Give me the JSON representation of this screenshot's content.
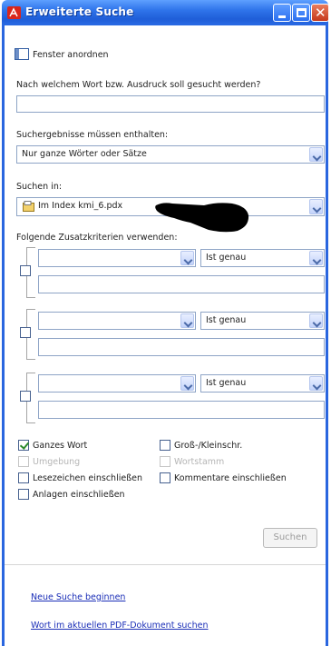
{
  "window": {
    "title": "Erweiterte Suche",
    "close_glyph": "✕"
  },
  "arrange": {
    "label": "Fenster anordnen"
  },
  "search": {
    "question": "Nach welchem Wort bzw. Ausdruck soll gesucht werden?",
    "value": "",
    "results_label": "Suchergebnisse müssen enthalten:",
    "results_value": "Nur ganze Wörter oder Sätze",
    "scope_label": "Suchen in:",
    "scope_value": "Im Index kmi_6.pdx"
  },
  "criteria": {
    "label": "Folgende Zusatzkriterien verwenden:",
    "rows": [
      {
        "field": "",
        "operator": "Ist genau",
        "value": ""
      },
      {
        "field": "",
        "operator": "Ist genau",
        "value": ""
      },
      {
        "field": "",
        "operator": "Ist genau",
        "value": ""
      }
    ]
  },
  "options": {
    "whole_word": {
      "label": "Ganzes Wort",
      "checked": true
    },
    "case": {
      "label": "Groß-/Kleinschr.",
      "checked": false
    },
    "proximity": {
      "label": "Umgebung",
      "disabled": true
    },
    "stemming": {
      "label": "Wortstamm",
      "disabled": true
    },
    "bookmarks": {
      "label": "Lesezeichen einschließen",
      "checked": false
    },
    "comments": {
      "label": "Kommentare einschließen",
      "checked": false
    },
    "attachments": {
      "label": "Anlagen einschließen",
      "checked": false
    }
  },
  "actions": {
    "search_button": "Suchen",
    "new_search_link": "Neue Suche beginnen",
    "current_doc_link": "Wort im aktuellen PDF-Dokument suchen"
  },
  "colors": {
    "titlebar": "#2f74ea",
    "link": "#1a2eb7",
    "close_button": "#c6391b"
  }
}
